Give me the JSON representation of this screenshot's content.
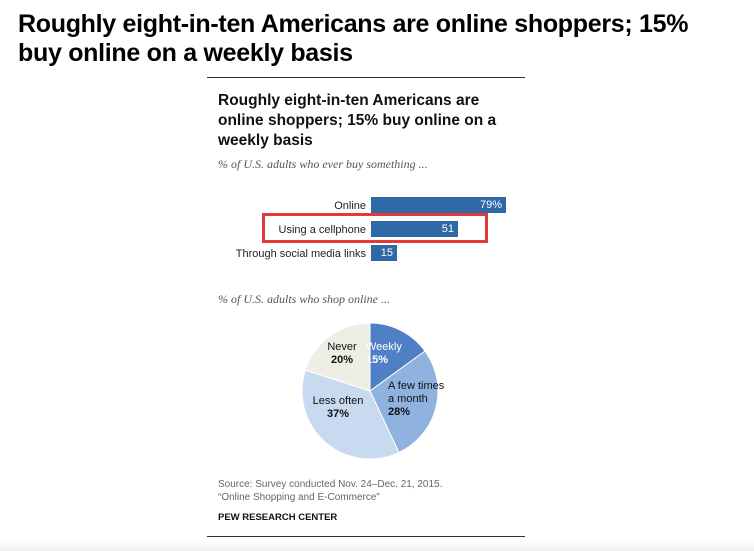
{
  "page": {
    "title": "Roughly eight-in-ten Americans are online shoppers; 15% buy online on a weekly basis"
  },
  "figure": {
    "title": "Roughly eight-in-ten Americans are online shoppers; 15% buy online on a weekly basis",
    "subtitle_bars": "% of U.S. adults who ever buy something ...",
    "subtitle_pie": "% of U.S. adults who shop online ...",
    "source_line1": "Source: Survey conducted Nov. 24–Dec. 21, 2015.",
    "source_line2": "“Online Shopping and E-Commerce”",
    "credit": "PEW RESEARCH CENTER"
  },
  "colors": {
    "bar": "#2f6aa6",
    "highlight": "#e03a3a",
    "pie_weekly": "#4f7fc4",
    "pie_few_times": "#8fb2df",
    "pie_less_often": "#c8daf0",
    "pie_never": "#eeeee4"
  },
  "chart_data": [
    {
      "type": "bar",
      "orientation": "horizontal",
      "categories": [
        "Online",
        "Using a cellphone",
        "Through social media links"
      ],
      "values": [
        79,
        51,
        15
      ],
      "value_labels": [
        "79%",
        "51",
        "15"
      ],
      "highlighted_category": "Using a cellphone",
      "xlim": [
        0,
        100
      ]
    },
    {
      "type": "pie",
      "slices": [
        {
          "label": "Weekly",
          "value": 15,
          "value_label": "15%"
        },
        {
          "label": "A few times a month",
          "value": 28,
          "value_label": "28%"
        },
        {
          "label": "Less often",
          "value": 37,
          "value_label": "37%"
        },
        {
          "label": "Never",
          "value": 20,
          "value_label": "20%"
        }
      ]
    }
  ]
}
